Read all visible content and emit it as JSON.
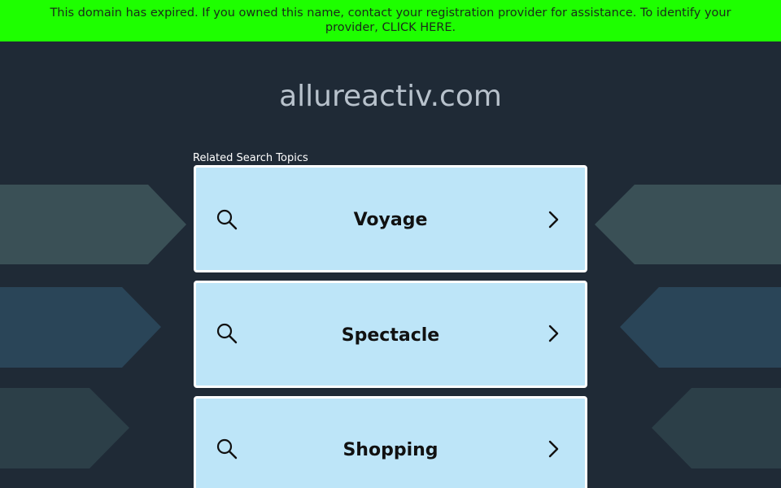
{
  "banner": {
    "message": "This domain has expired. If you owned this name, contact your registration provider for assistance. To identify your provider,",
    "link": "CLICK HERE."
  },
  "domain": "allureactiv.com",
  "related_label": "Related Search Topics",
  "topics": [
    {
      "label": "Voyage",
      "icon": "search-icon",
      "arrow": "chevron-right-icon"
    },
    {
      "label": "Spectacle",
      "icon": "search-icon",
      "arrow": "chevron-right-icon"
    },
    {
      "label": "Shopping",
      "icon": "search-icon",
      "arrow": "chevron-right-icon"
    }
  ],
  "colors": {
    "banner_bg": "#1eff00",
    "page_bg": "#1f2a36",
    "topic_bg": "#bde5f8",
    "topic_border": "#ffffff",
    "domain_text": "#b8c2cc"
  }
}
